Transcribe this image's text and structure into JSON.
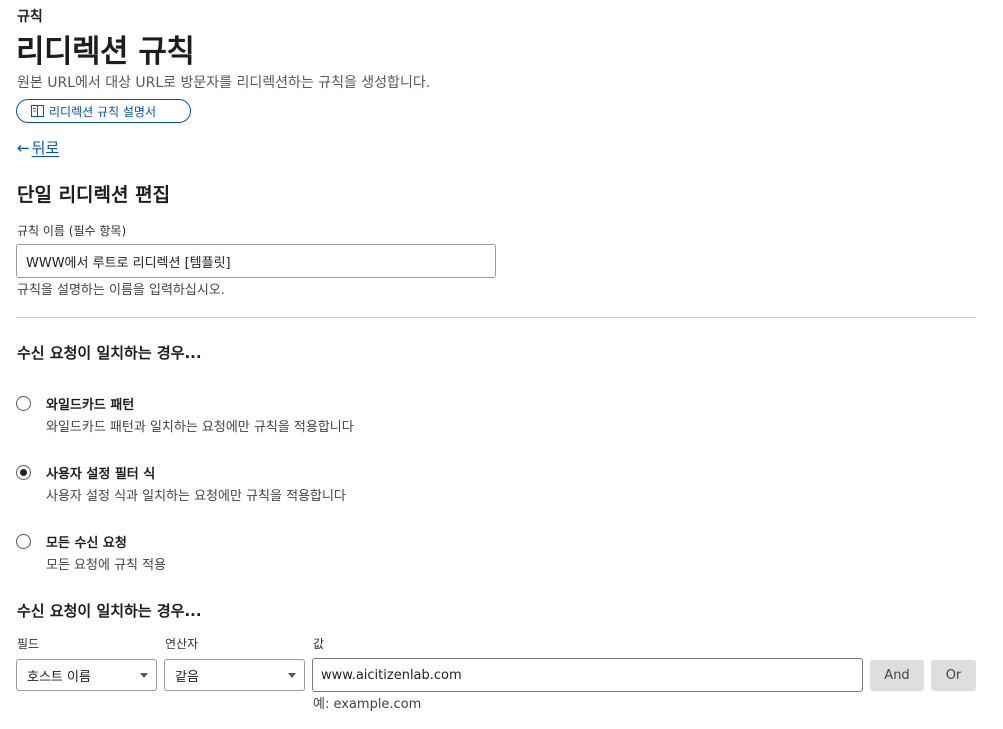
{
  "breadcrumb": "규칙",
  "page_title": "리디렉션 규칙",
  "page_description": "원본 URL에서 대상 URL로 방문자를 리디렉션하는 규칙을 생성합니다.",
  "doc_link_label": "리디렉션 규칙 설명서",
  "back_label": "뒤로",
  "form": {
    "section_title": "단일 리디렉션 편집",
    "rule_name_label": "규칙 이름 (필수 항목)",
    "rule_name_value": "WWW에서 루트로 리디렉션 [템플릿]",
    "rule_name_help": "규칙을 설명하는 이름을 입력하십시오.",
    "match_heading": "수신 요청이 일치하는 경우...",
    "options": [
      {
        "title": "와일드카드 패턴",
        "description": "와일드카드 패턴과 일치하는 요청에만 규칙을 적용합니다",
        "selected": false
      },
      {
        "title": "사용자 설정 필터 식",
        "description": "사용자 설정 식과 일치하는 요청에만 규칙을 적용합니다",
        "selected": true
      },
      {
        "title": "모든 수신 요청",
        "description": "모든 요청에 규칙 적용",
        "selected": false
      }
    ],
    "expression_heading": "수신 요청이 일치하는 경우...",
    "expression": {
      "field_label": "필드",
      "operator_label": "연산자",
      "value_label": "값",
      "field_value": "호스트 이름",
      "operator_value": "같음",
      "value_value": "www.aicitizenlab.com",
      "value_example": "예: example.com",
      "and_label": "And",
      "or_label": "Or"
    }
  },
  "colors": {
    "accent": "#0051c3",
    "button_bg": "#dedede",
    "divider": "#c8c8c8"
  }
}
